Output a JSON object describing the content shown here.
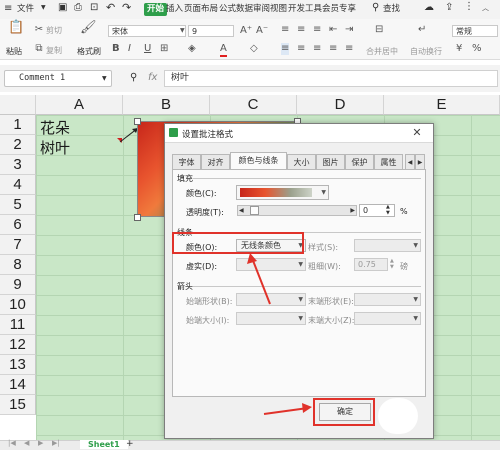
{
  "menu": {
    "file": "文件",
    "items": [
      "开始",
      "插入",
      "页面布局",
      "公式",
      "数据",
      "审阅",
      "视图",
      "开发工具",
      "会员专享"
    ],
    "search_label": "查找"
  },
  "ribbon": {
    "paste": "粘贴",
    "cut": "剪切",
    "copy": "复制",
    "format_painter": "格式刷",
    "font_name": "宋体",
    "font_size": "9",
    "merge_center": "合并居中",
    "wrap_text": "自动换行",
    "number_format": "常规",
    "bold": "B",
    "italic": "I",
    "underline": "U",
    "font_color_letter": "A"
  },
  "formula_bar": {
    "name_box": "Comment 1",
    "fx": "fx",
    "content": "树叶"
  },
  "grid": {
    "columns": [
      "A",
      "B",
      "C",
      "D",
      "E"
    ],
    "rows": [
      "1",
      "2",
      "3",
      "4",
      "5",
      "6",
      "7",
      "8",
      "9",
      "10",
      "11",
      "12",
      "13",
      "14",
      "15"
    ],
    "cells": {
      "A1": "花朵",
      "A2": "树叶"
    }
  },
  "sheet_tabs": {
    "active": "Sheet1",
    "add": "+"
  },
  "dialog": {
    "title": "设置批注格式",
    "tabs": [
      "字体",
      "对齐",
      "颜色与线条",
      "大小",
      "图片",
      "保护",
      "属性"
    ],
    "active_tab": "颜色与线条",
    "fill": {
      "section": "填充",
      "color_label": "颜色(C):",
      "transparency_label": "透明度(T):",
      "transparency_value": "0",
      "percent": "%"
    },
    "line": {
      "section": "线条",
      "color_label": "颜色(O):",
      "color_value": "无线条颜色",
      "style_label": "样式(S):",
      "dash_label": "虚实(D):",
      "weight_label": "粗细(W):",
      "weight_value": "0.75",
      "weight_unit": "磅"
    },
    "arrows": {
      "section": "箭头",
      "begin_style_label": "始端形状(B):",
      "end_style_label": "末端形状(E):",
      "begin_size_label": "始端大小(I):",
      "end_size_label": "末端大小(Z):"
    },
    "ok_button": "确定"
  },
  "colors": {
    "accent": "#2e9e4a",
    "cell_fill": "#c9e7c7",
    "highlight": "#e0322a"
  }
}
